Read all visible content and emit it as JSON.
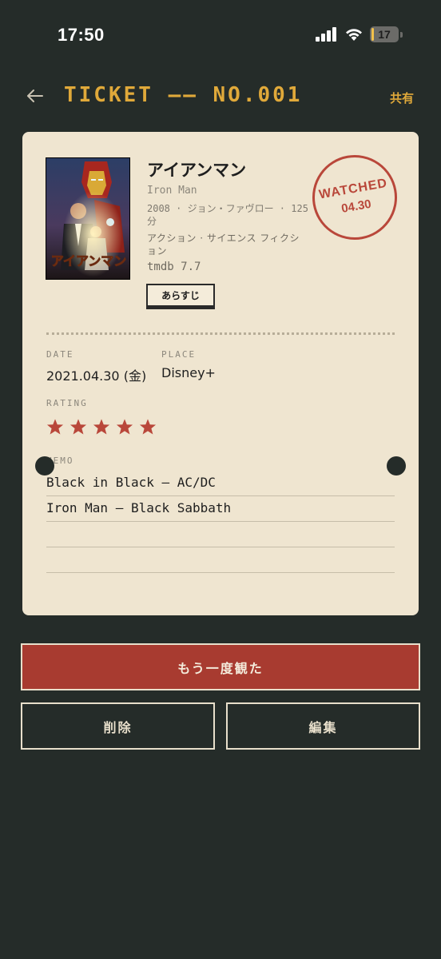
{
  "status_bar": {
    "time": "17:50",
    "battery": "17",
    "icons": [
      "signal-icon",
      "wifi-icon",
      "battery-icon"
    ]
  },
  "header": {
    "back_icon": "back-arrow-icon",
    "title": "TICKET —— NO.001",
    "share_label": "共有"
  },
  "movie": {
    "title": "アイアンマン",
    "original_title": "Iron Man",
    "meta": "2008 · ジョン・ファヴロー · 125分",
    "genres": "アクション · サイエンス フィクション",
    "tmdb": "tmdb 7.7",
    "synopsis_label": "あらすじ",
    "poster_text": "アイアンマン"
  },
  "stamp": {
    "label": "WATCHED",
    "date": "04.30"
  },
  "details": {
    "date_label": "DATE",
    "date_value": "2021.04.30 (金)",
    "place_label": "PLACE",
    "place_value": "Disney+",
    "rating_label": "RATING",
    "rating": 5,
    "rating_max": 5,
    "memo_label": "MEMO",
    "memo_lines": [
      "Black in Black – AC/DC",
      "Iron Man – Black Sabbath",
      "",
      ""
    ]
  },
  "actions": {
    "watch_again": "もう一度観た",
    "delete": "削除",
    "edit": "編集"
  },
  "colors": {
    "background": "#252c29",
    "ticket": "#efe5d0",
    "accent_gold": "#e0a93a",
    "accent_red": "#a83b30",
    "stamp_red": "#b9473a"
  }
}
